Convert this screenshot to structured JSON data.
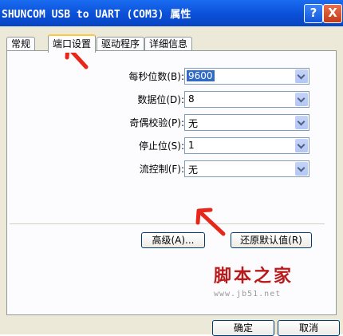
{
  "window": {
    "title": "SHUNCOM USB to UART (COM3) 属性",
    "help_label": "?",
    "close_label": "X"
  },
  "tabs": [
    {
      "label": "常规"
    },
    {
      "label": "端口设置"
    },
    {
      "label": "驱动程序"
    },
    {
      "label": "详细信息"
    }
  ],
  "settings": {
    "bits_per_second": {
      "label": "每秒位数(B):",
      "value": "9600"
    },
    "data_bits": {
      "label": "数据位(D):",
      "value": "8"
    },
    "parity": {
      "label": "奇偶校验(P):",
      "value": "无"
    },
    "stop_bits": {
      "label": "停止位(S):",
      "value": "1"
    },
    "flow_control": {
      "label": "流控制(F):",
      "value": "无"
    }
  },
  "buttons": {
    "advanced": "高级(A)...",
    "restore_defaults": "还原默认值(R)",
    "ok": "确定",
    "cancel": "取消"
  },
  "watermark": {
    "text": "脚本之家",
    "url": "www.jb51.net"
  },
  "colors": {
    "titlebar": "#0a4fd8",
    "dialog_bg": "#ece9d8",
    "annotation_arrow": "#e8271b",
    "watermark": "#b81b1b"
  }
}
